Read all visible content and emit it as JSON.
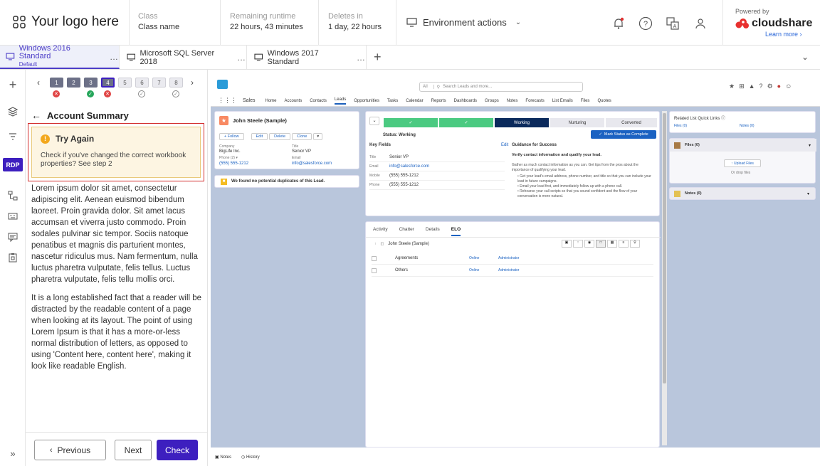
{
  "header": {
    "logo_text": "Your logo here",
    "class_label": "Class",
    "class_value": "Class name",
    "runtime_label": "Remaining runtime",
    "runtime_value": "22 hours, 43 minutes",
    "deletes_label": "Deletes in",
    "deletes_value": "1 day, 22 hours",
    "env_actions": "Environment actions",
    "powered_by": "Powered by",
    "brand": "cloudshare",
    "learn_more": "Learn more ›"
  },
  "vm_tabs": [
    {
      "label": "Windows 2016 Standard",
      "sub": "Default",
      "dots": "…"
    },
    {
      "label": "Microsoft SQL Server 2018",
      "dots": "…"
    },
    {
      "label": "Windows 2017 Standard",
      "dots": "…"
    }
  ],
  "rail": {
    "rdp": "RDP"
  },
  "steps": {
    "items": [
      "1",
      "2",
      "3",
      "4",
      "5",
      "6",
      "7",
      "8"
    ],
    "status": [
      "failed",
      "passed",
      "failed",
      "",
      "",
      "pending",
      "",
      "pending"
    ]
  },
  "panel": {
    "title": "Account Summary",
    "alert_title": "Try Again",
    "alert_text": "Check if you've changed the correct workbook properties? See step 2",
    "para1": "Lorem ipsum dolor sit amet, consectetur adipiscing elit. Aenean euismod bibendum laoreet. Proin gravida dolor. Sit amet lacus accumsan et viverra justo commodo. Proin sodales pulvinar sic tempor. Sociis natoque penatibus et magnis dis parturient montes, nascetur ridiculus mus. Nam fermentum, nulla luctus pharetra vulputate, felis tellus. Luctus pharetra vulputate, felis tellu mollis orci.",
    "para2": "It is a long established fact that a reader will be distracted by the readable content of a page when looking at its layout. The point of using Lorem Ipsum is that it has a more-or-less normal distribution of letters, as opposed to using 'Content here, content here', making it look like readable English.",
    "previous": "Previous",
    "next": "Next",
    "check": "Check"
  },
  "sf": {
    "app": "Sales",
    "search_scope": "All",
    "search_placeholder": "Search Leads and more...",
    "nav": [
      "Home",
      "Accounts",
      "Contacts",
      "Leads",
      "Opportunities",
      "Tasks",
      "Calendar",
      "Reports",
      "Dashboards",
      "Groups",
      "Notes",
      "Forecasts",
      "List Emails",
      "Files",
      "Quotes"
    ],
    "lead_name": "John Steele (Sample)",
    "follow": "+ Follow",
    "edit": "Edit",
    "delete": "Delete",
    "clone": "Clone",
    "company_label": "Company",
    "company": "BigLife Inc.",
    "title_label": "Title",
    "title": "Senior VP",
    "phone_label": "Phone (2) ▾",
    "phone": "(555) 555-1212",
    "email_label": "Email",
    "email": "info@salesforce.com",
    "dupes": "We found no potential duplicates of this Lead.",
    "path": [
      "✓",
      "✓",
      "Working",
      "Nurturing",
      "Converted"
    ],
    "status": "Status: Working",
    "mark_complete": "Mark Status as Complete",
    "key_fields": "Key Fields",
    "kf_edit": "Edit",
    "kf": [
      {
        "label": "Title",
        "value": "Senior VP"
      },
      {
        "label": "Email",
        "value": "info@salesforce.com"
      },
      {
        "label": "Mobile",
        "value": "(555) 555-1212"
      },
      {
        "label": "Phone",
        "value": "(555) 555-1212"
      }
    ],
    "guidance_title": "Guidance for Success",
    "guidance_sub": "Verify contact information and qualify your lead.",
    "guidance_p": "Gather as much contact information as you can. Get tips from the pros about the importance of qualifying your lead.",
    "guidance_bullets": [
      "Get your lead's email address, phone number, and title so that you can include your lead in future campaigns.",
      "Email your lead first, and immediately follow up with a phone call.",
      "Rehearse your call scripts so that you sound confident and the flow of your conversation is more natural."
    ],
    "tabs": [
      "Activity",
      "Chatter",
      "Details",
      "ELO"
    ],
    "elo_name": "John Steele (Sample)",
    "elo_rows": [
      {
        "name": "Agreements",
        "status": "Online",
        "owner": "Administrator"
      },
      {
        "name": "Others",
        "status": "Online",
        "owner": "Administrator"
      }
    ],
    "related_title": "Related List Quick Links",
    "files_link": "Files (0)",
    "notes_link": "Notes (0)",
    "files_card": "Files (0)",
    "upload": "Upload Files",
    "drop": "Or drop files",
    "notes_card": "Notes (0)",
    "footer_notes": "Notes",
    "footer_history": "History"
  }
}
